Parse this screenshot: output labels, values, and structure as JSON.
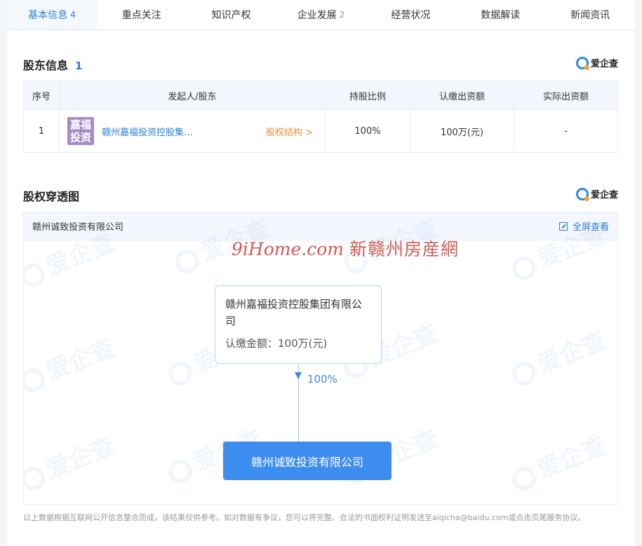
{
  "tabs": [
    {
      "label": "基本信息",
      "count": "4"
    },
    {
      "label": "重点关注",
      "count": ""
    },
    {
      "label": "知识产权",
      "count": ""
    },
    {
      "label": "企业发展",
      "count": "2"
    },
    {
      "label": "经营状况",
      "count": ""
    },
    {
      "label": "数据解读",
      "count": ""
    },
    {
      "label": "新闻资讯",
      "count": ""
    }
  ],
  "brand": {
    "label": "爱企查"
  },
  "shareholders": {
    "title": "股东信息",
    "count": "1",
    "columns": [
      "序号",
      "发起人/股东",
      "持股比例",
      "认缴出资额",
      "实际出资额"
    ],
    "rows": [
      {
        "index": "1",
        "avatar_text": "嘉福投资",
        "name": "赣州嘉福投资控股集…",
        "equity_link": "股权结构 >",
        "ratio": "100%",
        "subscribed": "100万(元)",
        "paid": "-"
      }
    ]
  },
  "penetration": {
    "title": "股权穿透图",
    "company": "赣州诚致投资有限公司",
    "fullscreen": "全屏查看",
    "overlay_brand_latin": "9iHome.com",
    "overlay_brand_cn": "新赣州房産網",
    "parent_name": "赣州嘉福投资控股集团有限公司",
    "parent_amount": "认缴金额：100万(元)",
    "edge_percent": "100%",
    "child_name": "赣州诚致投资有限公司",
    "watermark_text": "爱企查"
  },
  "footer": {
    "text": "以上数据根据互联网公开信息整合而成，该结果仅供参考。如对数据有争议，您可以将完整、合法的书面权利证明发送至aiqicha@baidu.com或点击页尾服务协议。"
  },
  "colors": {
    "accent": "#2b7fd8",
    "node_fill": "#3d8df0",
    "link_orange": "#f08b30",
    "avatar": "#a68ac7"
  }
}
